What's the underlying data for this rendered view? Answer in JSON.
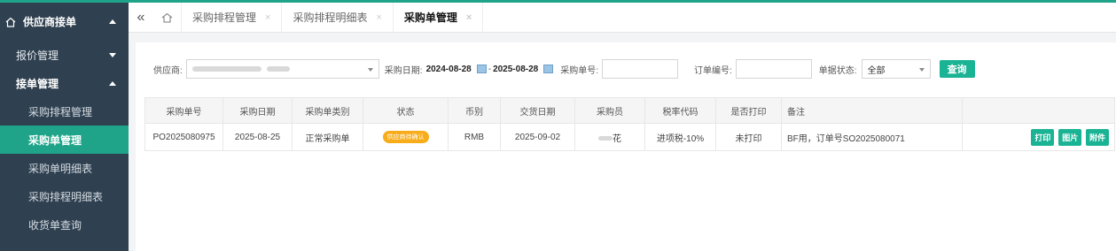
{
  "colors": {
    "accent": "#1fa48a",
    "sidebar_bg": "#2f4050",
    "badge": "#f8ac1a",
    "button": "#1ab394"
  },
  "sidebar": {
    "header": {
      "label": "供应商接单",
      "icon": "home-icon"
    },
    "groups": [
      {
        "label": "报价管理",
        "expanded": false
      },
      {
        "label": "接单管理",
        "expanded": true
      }
    ],
    "items": [
      {
        "label": "采购排程管理"
      },
      {
        "label": "采购单管理"
      },
      {
        "label": "采购单明细表"
      },
      {
        "label": "采购排程明细表"
      },
      {
        "label": "收货单查询"
      }
    ],
    "active_item": "采购单管理"
  },
  "tabs": {
    "back_icon": "double-left-chevron-icon",
    "home_icon": "home-icon",
    "items": [
      {
        "label": "采购排程管理",
        "close": "×"
      },
      {
        "label": "采购排程明细表",
        "close": "×"
      },
      {
        "label": "采购单管理",
        "close": "×"
      }
    ],
    "active": "采购单管理"
  },
  "filters": {
    "supplier_label": "供应商:",
    "date_label": "采购日期:",
    "date_from": "2024-08-28",
    "date_sep": "-",
    "date_to": "2025-08-28",
    "po_no_label": "采购单号:",
    "po_no_value": "",
    "order_no_label": "订单编号:",
    "order_no_value": "",
    "status_label": "单据状态:",
    "status_value": "全部",
    "search_button": "查询"
  },
  "table": {
    "columns": [
      "采购单号",
      "采购日期",
      "采购单类别",
      "状态",
      "币别",
      "交货日期",
      "采购员",
      "税率代码",
      "是否打印",
      "备注",
      ""
    ],
    "rows": [
      {
        "po_no": "PO2025080975",
        "po_date": "2025-08-25",
        "category": "正常采购单",
        "status": "供应商待确认",
        "currency": "RMB",
        "delivery_date": "2025-09-02",
        "buyer": "花",
        "tax_code": "进项税-10%",
        "printed": "未打印",
        "remark": "BF用，订单号SO2025080071",
        "actions": [
          "打印",
          "图片",
          "附件"
        ]
      }
    ]
  }
}
